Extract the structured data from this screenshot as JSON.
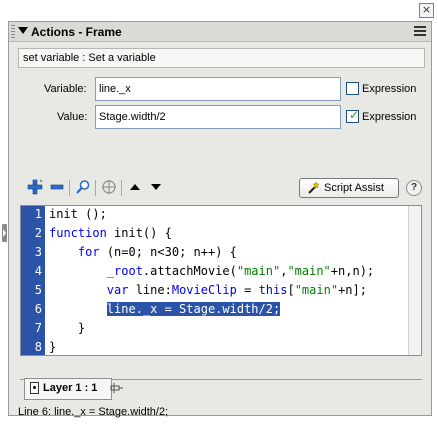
{
  "panel": {
    "title": "Actions - Frame",
    "close_glyph": "×",
    "options_icon": "panel-options-icon"
  },
  "description": "set variable : Set a variable",
  "variable": {
    "label": "Variable:",
    "value": "line._x",
    "expression_label": "Expression",
    "expression_checked": false
  },
  "value": {
    "label": "Value:",
    "value": "Stage.width/2",
    "expression_label": "Expression",
    "expression_checked": true
  },
  "toolbar": {
    "icons": [
      "add-statement-icon",
      "delete-statement-icon",
      "find-icon",
      "target-path-icon",
      "move-up-icon",
      "move-down-icon"
    ],
    "script_assist_label": "Script Assist",
    "help_glyph": "?"
  },
  "code": {
    "line_numbers": [
      "1",
      "2",
      "3",
      "4",
      "5",
      "6",
      "7",
      "8"
    ],
    "selected_line": 6
  },
  "layer_tab": {
    "label": "Layer 1 : 1"
  },
  "status": "Line 6: line._x = Stage.width/2;",
  "colors": {
    "gutter": "#2b54a8",
    "keyword": "#0000ee",
    "string": "#007f00",
    "checkmark": "#21a121"
  }
}
